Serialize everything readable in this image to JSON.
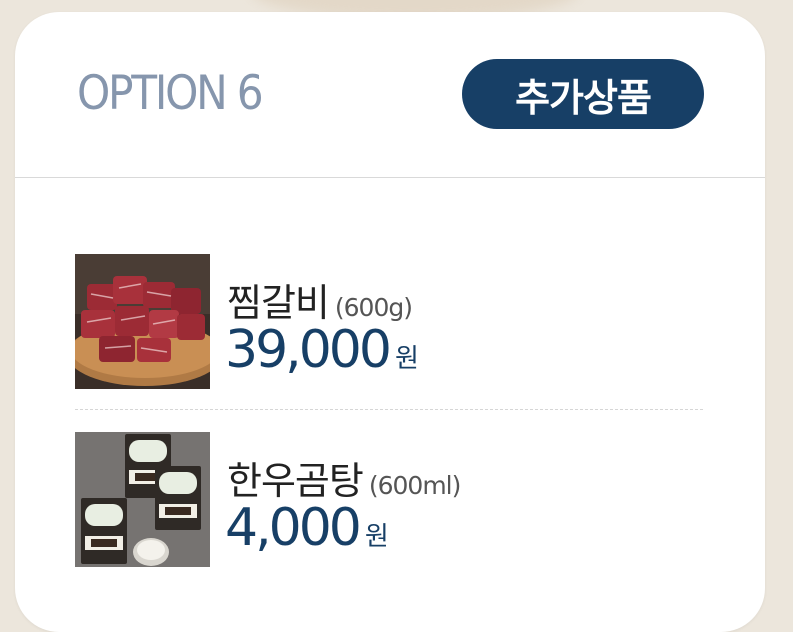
{
  "header": {
    "option_title": "OPTION 6",
    "badge_label": "추가상품"
  },
  "items": [
    {
      "name": "찜갈비",
      "qty": "(600g)",
      "price": "39,000",
      "currency": "원",
      "image": "braised-short-rib-photo"
    },
    {
      "name": "한우곰탕",
      "qty": "(600ml)",
      "price": "4,000",
      "currency": "원",
      "image": "beef-bone-soup-package-photo"
    }
  ],
  "colors": {
    "accent": "#173f66",
    "option_title": "#8696ad",
    "background": "#ece6dc",
    "card": "#ffffff"
  }
}
